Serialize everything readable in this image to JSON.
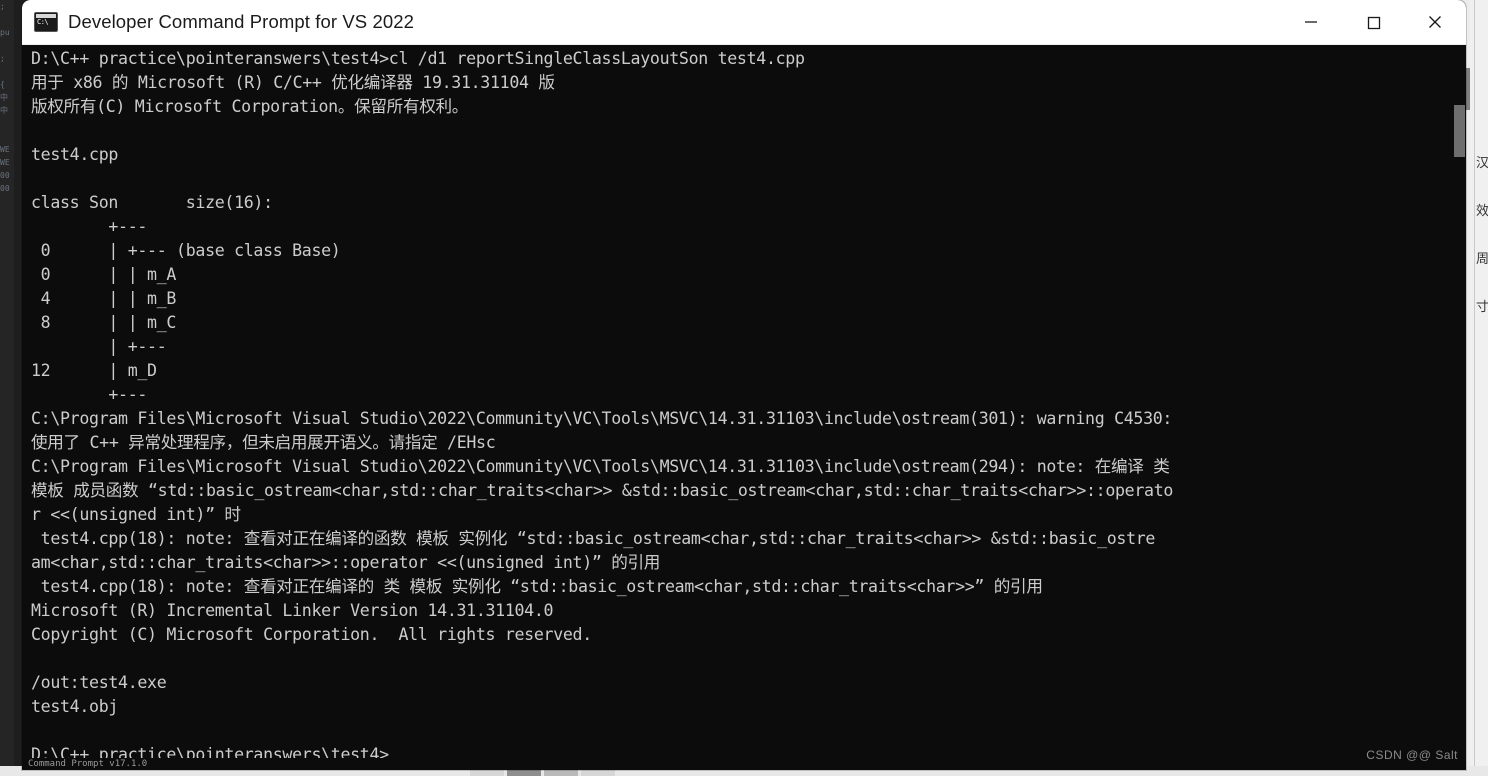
{
  "window": {
    "title": "Developer Command Prompt for VS 2022",
    "app_icon": "command-prompt-icon",
    "controls": {
      "minimize_label": "Minimize",
      "maximize_label": "Maximize",
      "close_label": "Close"
    }
  },
  "console": {
    "prompt_path": "D:\\C++ practice\\pointeranswers\\test4>",
    "command": "cl /d1 reportSingleClassLayoutSon test4.cpp",
    "compiler_banner_line1": "用于 x86 的 Microsoft (R) C/C++ 优化编译器 19.31.31104 版",
    "compiler_banner_line2": "版权所有(C) Microsoft Corporation。保留所有权利。",
    "source_file": "test4.cpp",
    "class_layout": {
      "header": "class Son\t\tsize(16):",
      "class_name": "Son",
      "size": 16,
      "base_class": "Base",
      "members": [
        {
          "offset": "0",
          "name": "m_A"
        },
        {
          "offset": "4",
          "name": "m_B"
        },
        {
          "offset": "8",
          "name": "m_C"
        },
        {
          "offset": "12",
          "name": "m_D"
        }
      ]
    },
    "warning_code": "C4530",
    "linker_version": "14.31.31104.0",
    "out_option": "/out:test4.exe",
    "obj_file": "test4.obj",
    "text": "D:\\C++ practice\\pointeranswers\\test4>cl /d1 reportSingleClassLayoutSon test4.cpp\n用于 x86 的 Microsoft (R) C/C++ 优化编译器 19.31.31104 版\n版权所有(C) Microsoft Corporation。保留所有权利。\n\ntest4.cpp\n\nclass Son       size(16):\n        +---\n 0      | +--- (base class Base)\n 0      | | m_A\n 4      | | m_B\n 8      | | m_C\n        | +---\n12      | m_D\n        +---\nC:\\Program Files\\Microsoft Visual Studio\\2022\\Community\\VC\\Tools\\MSVC\\14.31.31103\\include\\ostream(301): warning C4530:\n使用了 C++ 异常处理程序，但未启用展开语义。请指定 /EHsc\nC:\\Program Files\\Microsoft Visual Studio\\2022\\Community\\VC\\Tools\\MSVC\\14.31.31103\\include\\ostream(294): note: 在编译 类\n模板 成员函数 “std::basic_ostream<char,std::char_traits<char>> &std::basic_ostream<char,std::char_traits<char>>::operato\nr <<(unsigned int)” 时\n test4.cpp(18): note: 查看对正在编译的函数 模板 实例化 “std::basic_ostream<char,std::char_traits<char>> &std::basic_ostre\nam<char,std::char_traits<char>>::operator <<(unsigned int)” 的引用\n test4.cpp(18): note: 查看对正在编译的 类 模板 实例化 “std::basic_ostream<char,std::char_traits<char>>” 的引用\nMicrosoft (R) Incremental Linker Version 14.31.31104.0\nCopyright (C) Microsoft Corporation.  All rights reserved.\n\n/out:test4.exe\ntest4.obj\n\nD:\\C++ practice\\pointeranswers\\test4>"
  },
  "status_bar": {
    "text": "Command Prompt v17.1.0"
  },
  "watermark": {
    "text": "CSDN @@ Salt"
  },
  "background": {
    "left_editor_tokens": ";\n\npu\n\n;\n\n{\n中\n中\n\n\nWE\nWE\n00\n00",
    "right_panel_chars": "汉\n效\n周\n寸"
  },
  "colors": {
    "console_bg": "#0c0c0c",
    "console_fg": "#cccccc",
    "titlebar_bg": "#ffffff",
    "titlebar_fg": "#1b1b1b",
    "scrollbar_thumb": "#6e6e6e",
    "watermark_fg": "#8b8b8b"
  }
}
